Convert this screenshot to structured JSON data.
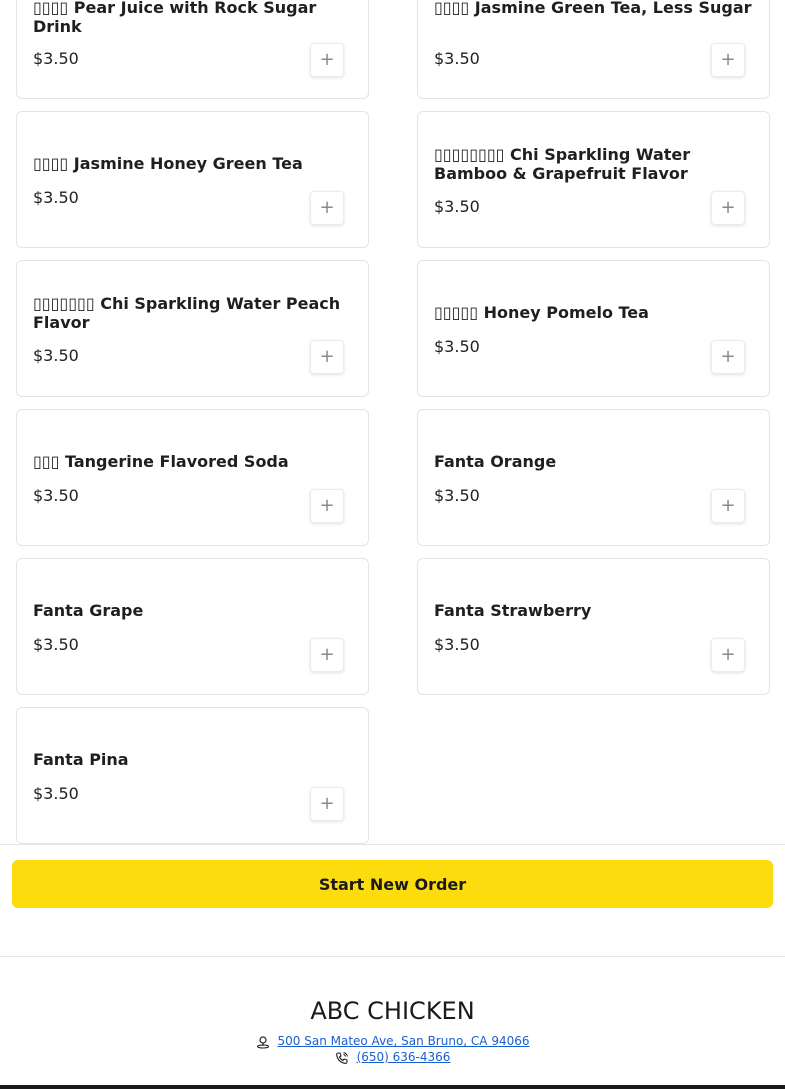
{
  "menu": {
    "items": [
      {
        "name": "▯▯▯▯ Pear Juice with Rock Sugar Drink",
        "price": "$3.50"
      },
      {
        "name": "▯▯▯▯ Jasmine Green Tea, Less Sugar",
        "price": "$3.50"
      },
      {
        "name": "▯▯▯▯ Jasmine Honey Green Tea",
        "price": "$3.50"
      },
      {
        "name": "▯▯▯▯▯▯▯▯ Chi Sparkling Water Bamboo & Grapefruit Flavor",
        "price": "$3.50"
      },
      {
        "name": "▯▯▯▯▯▯▯ Chi Sparkling Water Peach Flavor",
        "price": "$3.50"
      },
      {
        "name": "▯▯▯▯▯ Honey Pomelo Tea",
        "price": "$3.50"
      },
      {
        "name": "▯▯▯ Tangerine Flavored Soda",
        "price": "$3.50"
      },
      {
        "name": "Fanta Orange",
        "price": "$3.50"
      },
      {
        "name": "Fanta Grape",
        "price": "$3.50"
      },
      {
        "name": "Fanta Strawberry",
        "price": "$3.50"
      },
      {
        "name": "Fanta Pina",
        "price": "$3.50"
      }
    ],
    "add_label": "+"
  },
  "actions": {
    "start_new_order": "Start New Order"
  },
  "footer": {
    "restaurant_name": "ABC CHICKEN",
    "address": "500 San Mateo Ave, San Bruno, CA 94066",
    "phone": "(650) 636-4366",
    "address_icon": "map-pin-icon",
    "phone_icon": "phone-icon"
  },
  "colors": {
    "accent_button": "#fddc0e",
    "link": "#1a5fd1"
  }
}
